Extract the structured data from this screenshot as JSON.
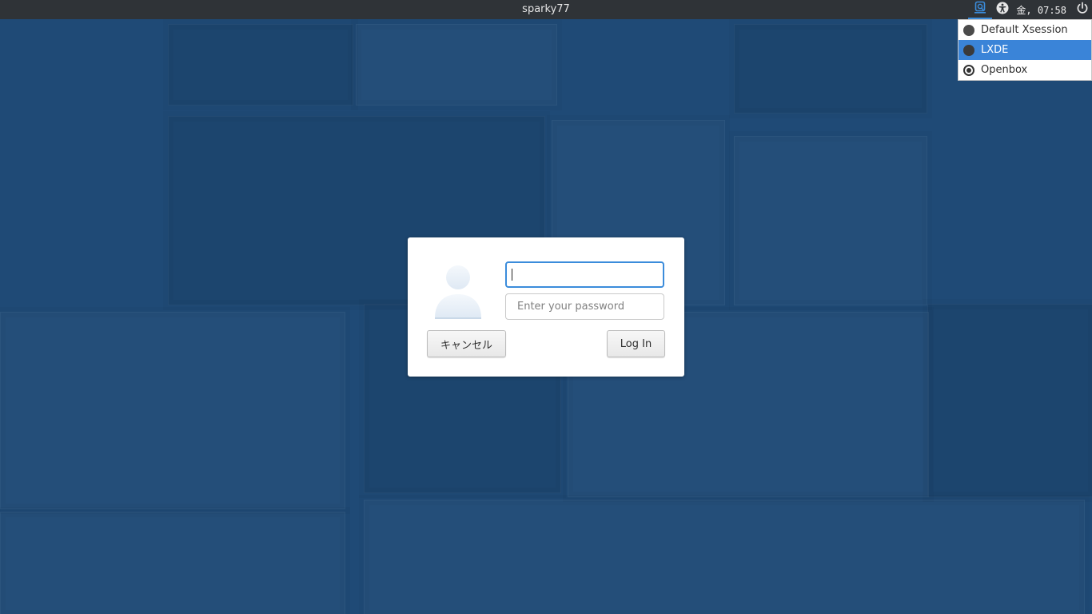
{
  "topbar": {
    "hostname": "sparky77",
    "clock": "金, 07:58",
    "indicators": [
      "session-icon",
      "accessibility-icon",
      "power-icon"
    ]
  },
  "session_menu": {
    "items": [
      {
        "label": "Default Xsession",
        "state": "unselected"
      },
      {
        "label": "LXDE",
        "state": "highlighted"
      },
      {
        "label": "Openbox",
        "state": "selected"
      }
    ]
  },
  "login": {
    "username_value": "",
    "password_placeholder": "Enter your password",
    "cancel_label": "キャンセル",
    "login_label": "Log In",
    "avatar_icon": "user-avatar-icon"
  },
  "colors": {
    "desktop_bg": "#1f4a76",
    "topbar_bg": "#2f3337",
    "accent": "#3a84d8"
  }
}
